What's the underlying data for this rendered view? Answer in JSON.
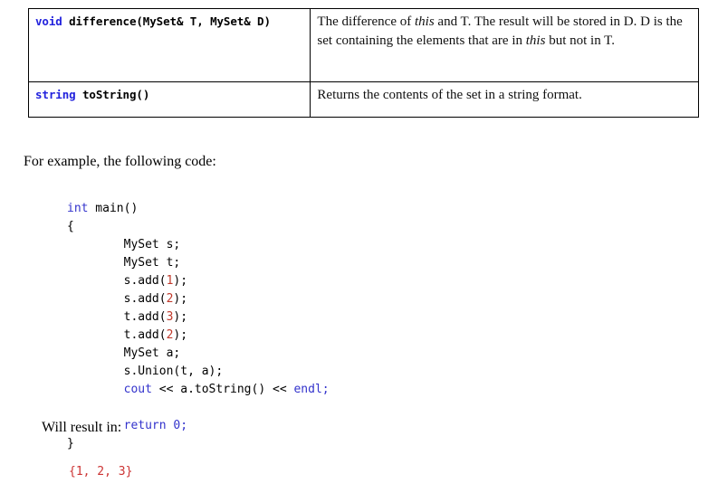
{
  "document": {
    "type": "reference-page",
    "colors": {
      "keyword": "#3333cc",
      "number": "#c0392b",
      "output": "#cc3333",
      "text": "#000000",
      "border": "#000000",
      "background": "#ffffff"
    }
  },
  "api_table": {
    "rows": [
      {
        "signature": {
          "keyword": "void",
          "rest": " difference(MySet& T, MySet& D)",
          "full": "void difference(MySet& T, MySet& D)"
        },
        "description": {
          "full": "The difference of this and T. The result will be stored in D. D is the set containing the elements that are in this but not in T.",
          "segments": [
            {
              "text": "The difference of ",
              "style": "normal"
            },
            {
              "text": "this",
              "style": "italic"
            },
            {
              "text": " and T. The result will be stored in D. D is the set containing the elements that are in ",
              "style": "normal"
            },
            {
              "text": "this",
              "style": "italic"
            },
            {
              "text": " but not in T.",
              "style": "normal"
            }
          ]
        }
      },
      {
        "signature": {
          "keyword": "string",
          "rest": " toString()",
          "full": "string toString()"
        },
        "description": {
          "full": "Returns the contents of the set in a string format.",
          "segments": [
            {
              "text": "Returns the contents of the set in a string format.",
              "style": "normal"
            }
          ]
        }
      }
    ]
  },
  "prose": {
    "intro": "For example, the following code:",
    "result": "Will result in:"
  },
  "code_sample": {
    "language": "cpp",
    "lines": [
      {
        "indent": 0,
        "tokens": [
          {
            "t": "int",
            "c": "kw"
          },
          {
            "t": " main()",
            "c": "plain"
          }
        ]
      },
      {
        "indent": 0,
        "tokens": [
          {
            "t": "{",
            "c": "plain"
          }
        ]
      },
      {
        "indent": 1,
        "tokens": [
          {
            "t": "MySet s;",
            "c": "plain"
          }
        ]
      },
      {
        "indent": 1,
        "tokens": [
          {
            "t": "MySet t;",
            "c": "plain"
          }
        ]
      },
      {
        "indent": 1,
        "tokens": [
          {
            "t": "s.add(",
            "c": "plain"
          },
          {
            "t": "1",
            "c": "num"
          },
          {
            "t": ");",
            "c": "plain"
          }
        ]
      },
      {
        "indent": 1,
        "tokens": [
          {
            "t": "s.add(",
            "c": "plain"
          },
          {
            "t": "2",
            "c": "num"
          },
          {
            "t": ");",
            "c": "plain"
          }
        ]
      },
      {
        "indent": 1,
        "tokens": [
          {
            "t": "t.add(",
            "c": "plain"
          },
          {
            "t": "3",
            "c": "num"
          },
          {
            "t": ");",
            "c": "plain"
          }
        ]
      },
      {
        "indent": 1,
        "tokens": [
          {
            "t": "t.add(",
            "c": "plain"
          },
          {
            "t": "2",
            "c": "num"
          },
          {
            "t": ");",
            "c": "plain"
          }
        ]
      },
      {
        "indent": 1,
        "tokens": [
          {
            "t": "MySet a;",
            "c": "plain"
          }
        ]
      },
      {
        "indent": 1,
        "tokens": [
          {
            "t": "s.Union(t, a);",
            "c": "plain"
          }
        ]
      },
      {
        "indent": 1,
        "tokens": [
          {
            "t": "cout",
            "c": "kw"
          },
          {
            "t": " << a.toString() << ",
            "c": "plain"
          },
          {
            "t": "endl;",
            "c": "kw"
          }
        ]
      },
      {
        "indent": 0,
        "tokens": [
          {
            "t": "",
            "c": "plain"
          }
        ]
      },
      {
        "indent": 1,
        "tokens": [
          {
            "t": "return 0;",
            "c": "kw"
          }
        ]
      },
      {
        "indent": 0,
        "tokens": [
          {
            "t": "}",
            "c": "plain"
          }
        ]
      }
    ],
    "plain_text": "int main()\n{\n        MySet s;\n        MySet t;\n        s.add(1);\n        s.add(2);\n        t.add(3);\n        t.add(2);\n        MySet a;\n        s.Union(t, a);\n        cout << a.toString() << endl;\n\n        return 0;\n}"
  },
  "code_output": {
    "text": "{1, 2, 3}"
  }
}
